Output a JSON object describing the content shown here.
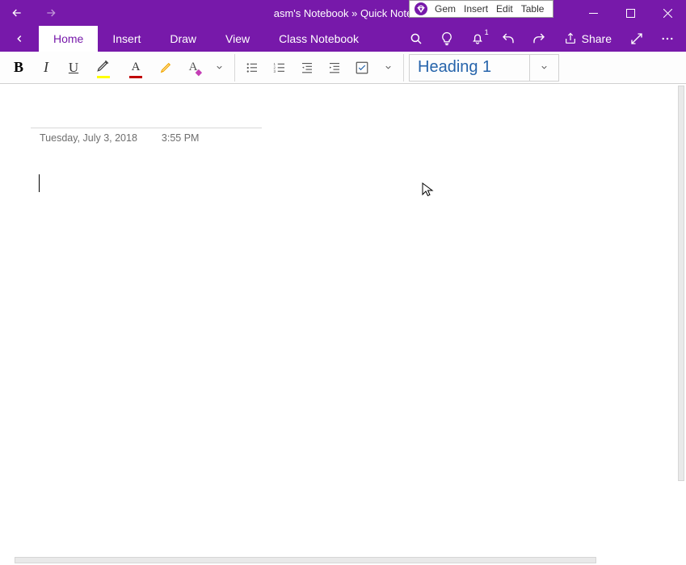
{
  "titlebar": {
    "title": "asm's Notebook » Quick Note"
  },
  "gem_menu": {
    "items": [
      "Gem",
      "Insert",
      "Edit",
      "Table"
    ]
  },
  "tabs": {
    "items": [
      "Home",
      "Insert",
      "Draw",
      "View",
      "Class Notebook"
    ],
    "active_index": 0
  },
  "right_tools": {
    "share_label": "Share",
    "notif_count": "1"
  },
  "ribbon": {
    "style_selector": "Heading 1",
    "colors": {
      "highlight": "#ffff00",
      "font_color": "#c00000"
    }
  },
  "page": {
    "date": "Tuesday, July 3, 2018",
    "time": "3:55 PM"
  }
}
